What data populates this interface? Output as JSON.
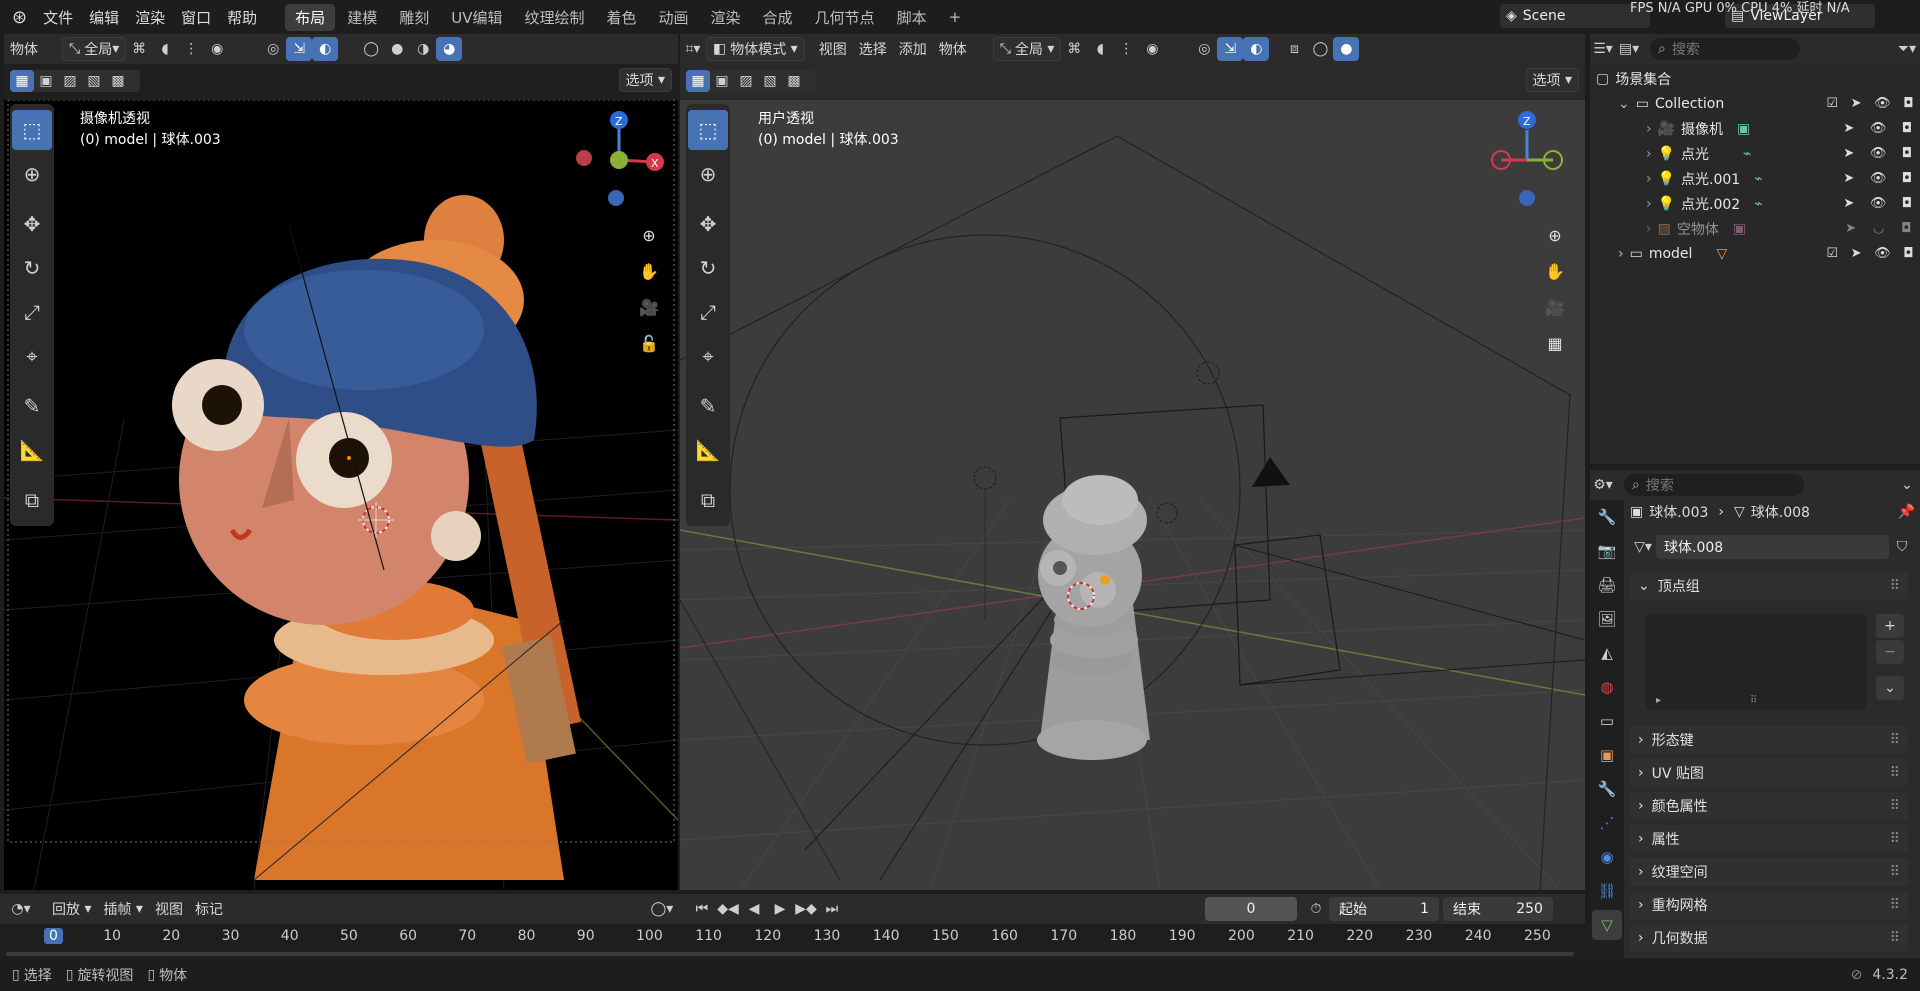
{
  "topbar": {
    "menus": [
      "文件",
      "编辑",
      "渲染",
      "窗口",
      "帮助"
    ],
    "workspaces": [
      "布局",
      "建模",
      "雕刻",
      "UV编辑",
      "纹理绘制",
      "着色",
      "动画",
      "渲染",
      "合成",
      "几何节点",
      "脚本"
    ],
    "active_workspace": "布局",
    "scene_name": "Scene",
    "view_layer": "ViewLayer",
    "stats": "FPS N/A GPU 0% CPU 4% 延时 N/A"
  },
  "left_view": {
    "header": {
      "mode": "物体",
      "transform": "全局",
      "options": "选项"
    },
    "overlay_title": "摄像机透视",
    "overlay_subtitle": "(0) model | 球体.003"
  },
  "right_view": {
    "header": {
      "mode": "物体模式",
      "menus": [
        "视图",
        "选择",
        "添加",
        "物体"
      ],
      "transform": "全局",
      "options": "选项"
    },
    "overlay_title": "用户透视",
    "overlay_subtitle": "(0) model | 球体.003"
  },
  "outliner": {
    "search_placeholder": "搜索",
    "scene_collection": "场景集合",
    "items": [
      {
        "label": "Collection",
        "indent": 1
      },
      {
        "label": "摄像机",
        "indent": 2
      },
      {
        "label": "点光",
        "indent": 2
      },
      {
        "label": "点光.001",
        "indent": 2
      },
      {
        "label": "点光.002",
        "indent": 2
      },
      {
        "label": "空物体",
        "indent": 2
      },
      {
        "label": "model",
        "indent": 1
      }
    ]
  },
  "properties": {
    "search_placeholder": "搜索",
    "breadcrumb_object": "球体.003",
    "breadcrumb_data": "球体.008",
    "mesh_name": "球体.008",
    "vertex_groups_label": "顶点组",
    "sections": [
      "形态键",
      "UV 贴图",
      "颜色属性",
      "属性",
      "纹理空间",
      "重构网格",
      "几何数据"
    ]
  },
  "timeline": {
    "menus": [
      "回放",
      "插帧",
      "视图",
      "标记"
    ],
    "current_frame": "0",
    "start_label": "起始",
    "start_value": "1",
    "end_label": "结束",
    "end_value": "250",
    "ticks": [
      "0",
      "10",
      "20",
      "30",
      "40",
      "50",
      "60",
      "70",
      "80",
      "90",
      "100",
      "110",
      "120",
      "130",
      "140",
      "150",
      "160",
      "170",
      "180",
      "190",
      "200",
      "210",
      "220",
      "230",
      "240",
      "250"
    ]
  },
  "statusbar": {
    "select": "选择",
    "rotate": "旋转视图",
    "object": "物体",
    "version": "4.3.2"
  }
}
